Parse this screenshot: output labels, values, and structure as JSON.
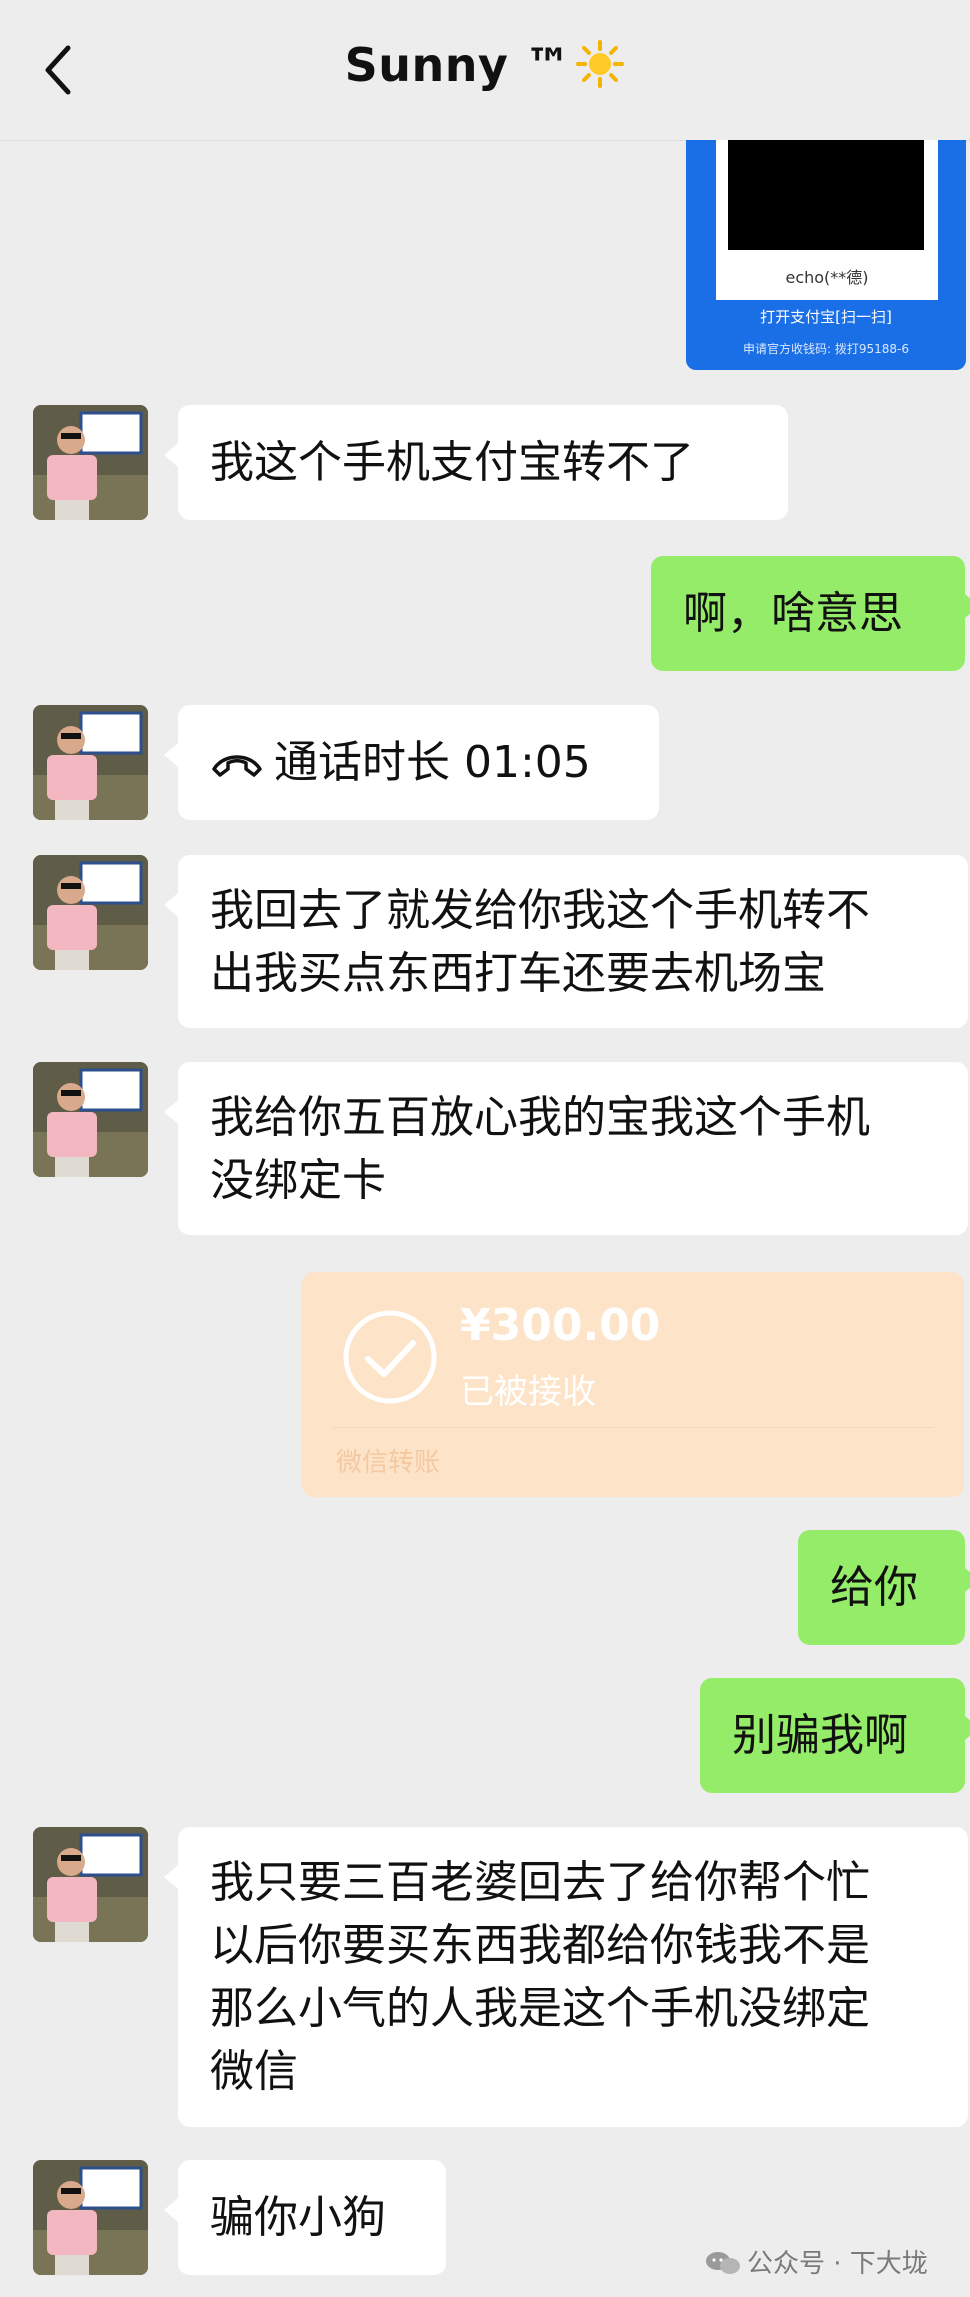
{
  "header": {
    "title": "Sunny ™"
  },
  "image_message": {
    "name": "echo(**德)",
    "open_text": "打开支付宝[扫一扫]",
    "footer": "申请官方收钱码: 拨打95188-6"
  },
  "messages": [
    {
      "side": "left",
      "text": "我这个手机支付宝转不了"
    },
    {
      "side": "right",
      "text": "啊，啥意思"
    },
    {
      "side": "left",
      "type": "call",
      "text": "通话时长 01:05"
    },
    {
      "side": "left",
      "lines": [
        "我回去了就发给你我这个手机转不",
        "出我买点东西打车还要去机场宝"
      ]
    },
    {
      "side": "left",
      "lines": [
        "我给你五百放心我的宝我这个手机",
        "没绑定卡"
      ]
    },
    {
      "side": "right",
      "text": "给你"
    },
    {
      "side": "right",
      "text": "别骗我啊"
    },
    {
      "side": "left",
      "lines": [
        "我只要三百老婆回去了给你帮个忙",
        "以后你要买东西我都给你钱我不是",
        "那么小气的人我是这个手机没绑定",
        "微信"
      ]
    },
    {
      "side": "left",
      "text": "骗你小狗"
    }
  ],
  "transfer": {
    "amount": "¥300.00",
    "status": "已被接收",
    "brand": "微信转账"
  },
  "watermark": {
    "text": "公众号 · 下大垅"
  },
  "colors": {
    "background": "#ededed",
    "bubble_self": "#95ec69",
    "bubble_other": "#ffffff",
    "transfer_bg": "#fde4c9"
  }
}
